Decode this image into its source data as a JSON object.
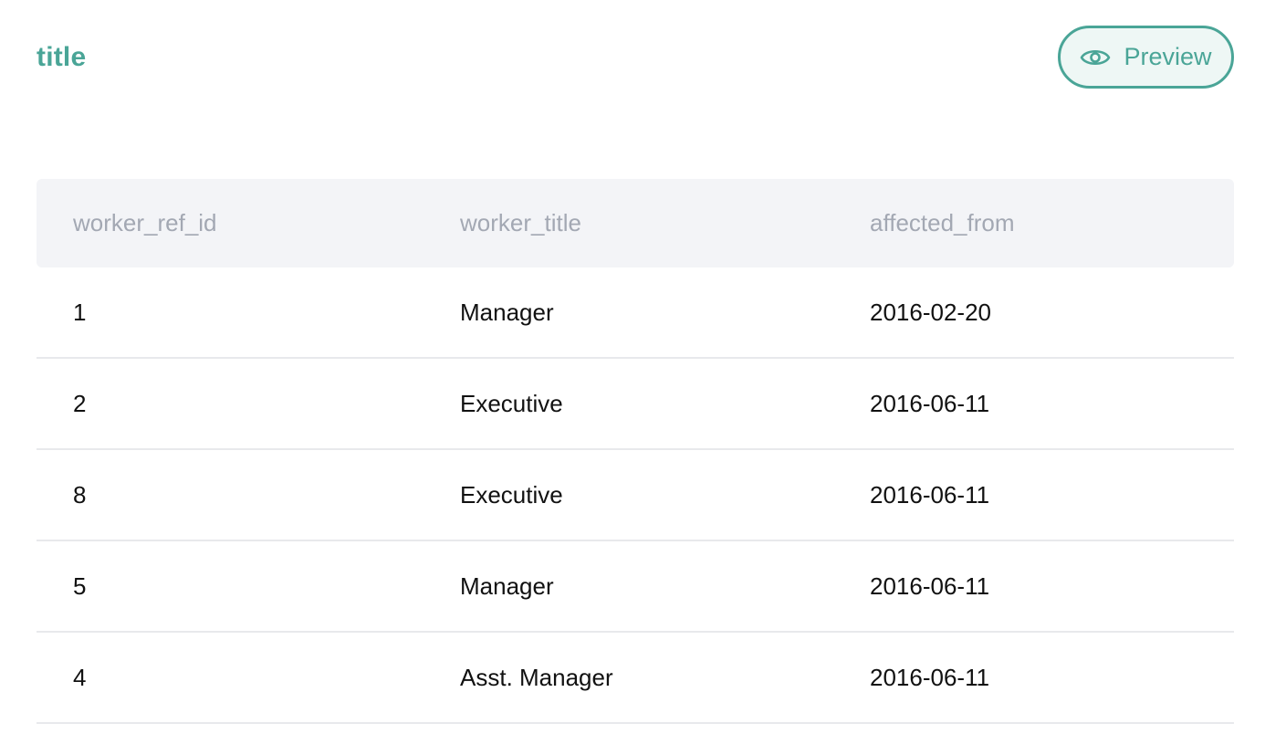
{
  "header": {
    "title": "title",
    "preview_label": "Preview",
    "preview_icon": "eye-icon",
    "accent_color": "#4aa597"
  },
  "table": {
    "columns": [
      "worker_ref_id",
      "worker_title",
      "affected_from"
    ],
    "rows": [
      [
        "1",
        "Manager",
        "2016-02-20"
      ],
      [
        "2",
        "Executive",
        "2016-06-11"
      ],
      [
        "8",
        "Executive",
        "2016-06-11"
      ],
      [
        "5",
        "Manager",
        "2016-06-11"
      ],
      [
        "4",
        "Asst. Manager",
        "2016-06-11"
      ]
    ]
  }
}
